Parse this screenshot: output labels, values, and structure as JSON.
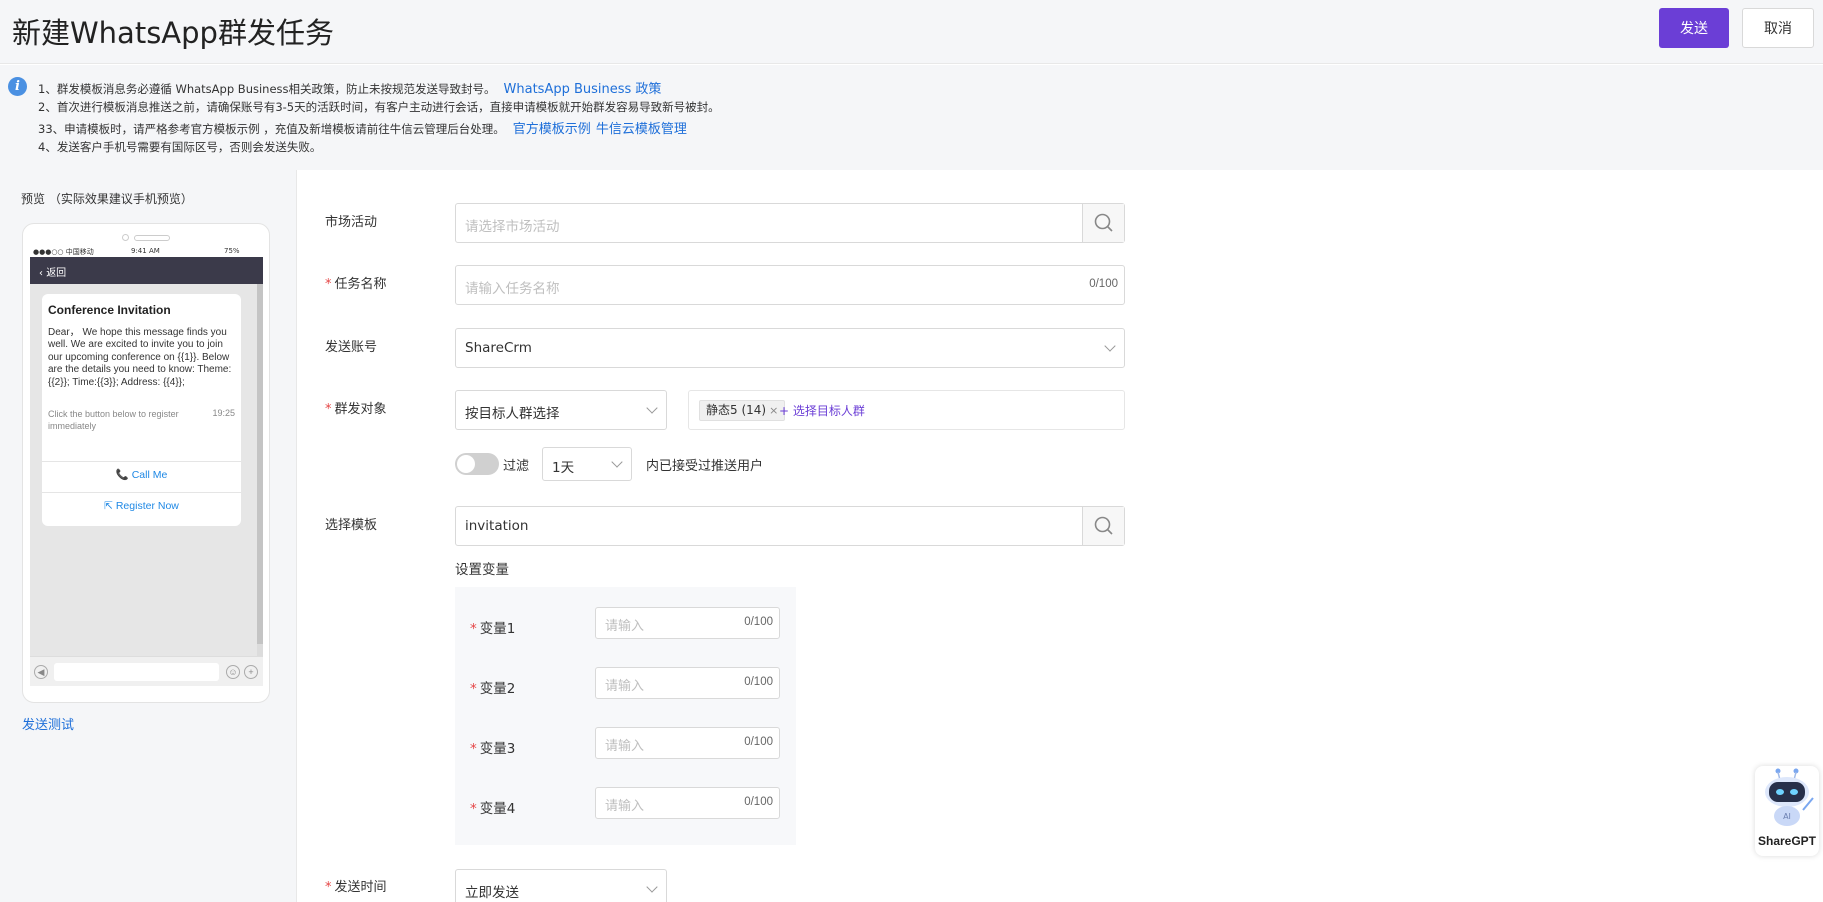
{
  "header": {
    "title": "新建WhatsApp群发任务",
    "send_label": "发送",
    "cancel_label": "取消"
  },
  "notice": {
    "lines": [
      "1、群发模板消息务必遵循 WhatsApp Business相关政策，防止未按规范发送导致封号。",
      "2、首次进行模板消息推送之前，请确保账号有3-5天的活跃时间，有客户主动进行会话，直接申请模板就开始群发容易导致新号被封。",
      "33、申请模板时，请严格参考官方模板示例 ，充值及新增模板请前往牛信云管理后台处理。",
      "4、发送客户手机号需要有国际区号，否则会发送失败。"
    ],
    "policy_link": "WhatsApp Business 政策",
    "template_example_link": "官方模板示例",
    "template_manage_link": "牛信云模板管理"
  },
  "preview": {
    "label": "预览 （实际效果建议手机预览）",
    "status_carrier": "●●●○○ 中国移动",
    "status_time": "9:41 AM",
    "status_battery": "75%",
    "back_label": "返回",
    "card_title": "Conference Invitation",
    "card_body": "Dear，  We hope this message finds you well. We are excited to invite you to join our upcoming conference on {{1}}. Below are the details you need to know: Theme: {{2}}; Time:{{3}}; Address: {{4}};",
    "card_footer": "Click the button below to register immediately",
    "card_time": "19:25",
    "btn_call": "Call Me",
    "btn_register": "Register Now",
    "send_test": "发送测试"
  },
  "form": {
    "activity_label": "市场活动",
    "activity_placeholder": "请选择市场活动",
    "task_name_label": "任务名称",
    "task_name_placeholder": "请输入任务名称",
    "task_name_count": "0/100",
    "account_label": "发送账号",
    "account_value": "ShareCrm",
    "target_label": "群发对象",
    "target_mode": "按目标人群选择",
    "target_tag": "静态5 (14)",
    "add_target": "+ 选择目标人群",
    "filter_label": "过滤",
    "filter_days": "1天",
    "filter_suffix": "内已接受过推送用户",
    "template_label": "选择模板",
    "template_value": "invitation",
    "vars_title": "设置变量",
    "variables": [
      {
        "label": "变量1",
        "placeholder": "请输入",
        "count": "0/100"
      },
      {
        "label": "变量2",
        "placeholder": "请输入",
        "count": "0/100"
      },
      {
        "label": "变量3",
        "placeholder": "请输入",
        "count": "0/100"
      },
      {
        "label": "变量4",
        "placeholder": "请输入",
        "count": "0/100"
      }
    ],
    "send_time_label": "发送时间",
    "send_time_value": "立即发送"
  },
  "assistant": {
    "label": "ShareGPT"
  },
  "colors": {
    "primary": "#6b3ed6",
    "link": "#1e6fd9",
    "required": "#e54545"
  }
}
